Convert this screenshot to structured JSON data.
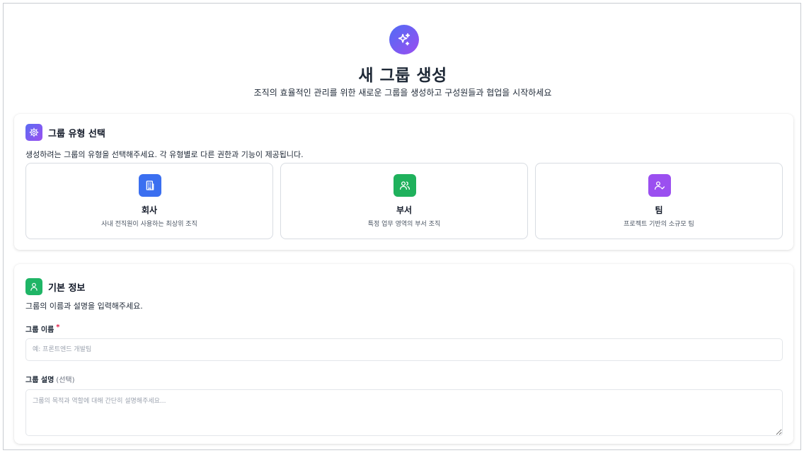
{
  "header": {
    "icon": "sparkles-icon",
    "title": "새 그룹 생성",
    "subtitle": "조직의 효율적인 관리를 위한 새로운 그룹을 생성하고 구성원들과 협업을 시작하세요"
  },
  "group_type": {
    "icon": "gear-icon",
    "title": "그룹 유형 선택",
    "description": "생성하려는 그룹의 유형을 선택해주세요. 각 유형별로 다른 권한과 기능이 제공됩니다.",
    "options": [
      {
        "icon": "building-icon",
        "name": "회사",
        "desc": "사내 전직원이 사용하는 최상위 조직",
        "color": "#3b6ff0"
      },
      {
        "icon": "users-icon",
        "name": "부서",
        "desc": "특정 업무 영역의 부서 조직",
        "color": "#1fb15c"
      },
      {
        "icon": "user-check-icon",
        "name": "팀",
        "desc": "프로젝트 기반의 소규모 팀",
        "color": "#9b4ff0"
      }
    ]
  },
  "basic_info": {
    "icon": "user-icon",
    "title": "기본 정보",
    "description": "그룹의 이름과 설명을 입력해주세요.",
    "name_label": "그룹 이름",
    "required_mark": "*",
    "name_placeholder": "예: 프론트엔드 개발팀",
    "name_value": "",
    "desc_label": "그룹 설명",
    "desc_optional": "(선택)",
    "desc_placeholder": "그룹의 목적과 역할에 대해 간단히 설명해주세요...",
    "desc_value": ""
  },
  "colors": {
    "accent_gradient_start": "#4f6df5",
    "accent_gradient_end": "#9b4df0",
    "required": "#e11d48"
  }
}
